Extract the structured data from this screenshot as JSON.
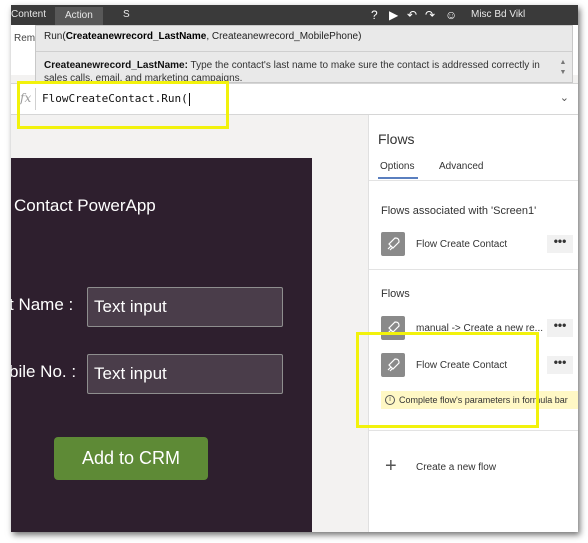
{
  "ribbon": {
    "tabs": [
      "Content",
      "Action",
      "S"
    ],
    "user_hint": "Misc  Bd Vikl"
  },
  "sub_row": {
    "label": "Remo"
  },
  "intellisense": {
    "signature_prefix": "Run(",
    "signature_active_param": "Createanewrecord_LastName",
    "signature_rest": ", Createanewrecord_MobilePhone)",
    "description_param": "Createanewrecord_LastName:",
    "description_text": " Type the contact's last name to make sure the contact is addressed correctly in sales calls, email, and marketing campaigns."
  },
  "formula_bar": {
    "fx_label": "fx",
    "formula": "FlowCreateContact.Run("
  },
  "app": {
    "title": "Contact PowerApp",
    "field1_label": "t Name :",
    "field1_value": "Text input",
    "field2_label": "bile No. :",
    "field2_value": "Text input",
    "button_label": "Add to CRM",
    "screen_color": "#2e1f2e",
    "button_color": "#5e8a36"
  },
  "panel": {
    "title": "Flows",
    "tabs": [
      "Options",
      "Advanced"
    ],
    "section_associated": "Flows associated with 'Screen1'",
    "associated_flows": [
      "Flow Create Contact"
    ],
    "section_flows": "Flows",
    "flows": [
      "manual -> Create a new re...",
      "Flow Create Contact"
    ],
    "more_label": "•••",
    "warning": "Complete flow's parameters in formula bar",
    "create_label": "Create a new flow"
  },
  "colors": {
    "highlight": "#f2f20c",
    "accent": "#5a7fbf"
  }
}
